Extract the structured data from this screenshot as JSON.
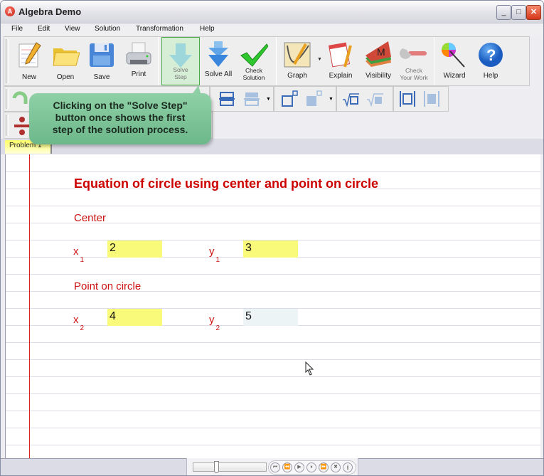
{
  "window": {
    "title": "Algebra Demo",
    "controls": {
      "minimize": "_",
      "maximize": "□",
      "close": "✕"
    }
  },
  "menu": [
    "File",
    "Edit",
    "View",
    "Solution",
    "Transformation",
    "Help"
  ],
  "toolbar": {
    "buttons": [
      {
        "id": "new",
        "label": "New",
        "icon": "new-document-icon"
      },
      {
        "id": "open",
        "label": "Open",
        "icon": "folder-icon"
      },
      {
        "id": "save",
        "label": "Save",
        "icon": "floppy-disk-icon"
      },
      {
        "id": "print",
        "label": "Print",
        "icon": "printer-icon"
      },
      {
        "id": "solve-step",
        "label_line1": "Solve",
        "label_line2": "Step",
        "icon": "arrow-down-icon",
        "active": true
      },
      {
        "id": "solve-all",
        "label": "Solve All",
        "icon": "double-arrow-down-icon"
      },
      {
        "id": "check-solution",
        "label_line1": "Check",
        "label_line2": "Solution",
        "icon": "checkmark-icon"
      },
      {
        "id": "graph",
        "label": "Graph",
        "icon": "graph-icon",
        "has_dropdown": true
      },
      {
        "id": "explain",
        "label": "Explain",
        "icon": "document-pencil-icon"
      },
      {
        "id": "visibility",
        "label": "Visibility",
        "icon": "layers-m-icon"
      },
      {
        "id": "check-your-work",
        "label_line1": "Check",
        "label_line2": "Your Work",
        "icon": "wrench-icon"
      },
      {
        "id": "wizard",
        "label": "Wizard",
        "icon": "magic-wand-icon"
      },
      {
        "id": "help",
        "label": "Help",
        "icon": "help-icon",
        "glyph": "?"
      }
    ]
  },
  "tooltip": {
    "text_line1": "Clicking on the \"Solve Step\"",
    "text_line2": "button once shows the first",
    "text_line3": "step of the solution process."
  },
  "tabs": [
    {
      "label": "Problem 1",
      "active": true
    }
  ],
  "document": {
    "title": "Equation of circle using center and point on circle",
    "sections": [
      {
        "heading": "Center",
        "fields": [
          {
            "var": "x",
            "sub": "1",
            "value": "2"
          },
          {
            "var": "y",
            "sub": "1",
            "value": "3"
          }
        ]
      },
      {
        "heading": "Point on circle",
        "fields": [
          {
            "var": "x",
            "sub": "2",
            "value": "4"
          },
          {
            "var": "y",
            "sub": "2",
            "value": "5"
          }
        ]
      }
    ]
  },
  "player": {
    "slider_fraction": 0.3,
    "buttons": [
      {
        "id": "first",
        "glyph": "⏮"
      },
      {
        "id": "rewind",
        "glyph": "⏪"
      },
      {
        "id": "play",
        "glyph": "▶"
      },
      {
        "id": "pause",
        "glyph": "⏸"
      },
      {
        "id": "fast-forward",
        "glyph": "⏩"
      },
      {
        "id": "stop",
        "glyph": "✖"
      },
      {
        "id": "info",
        "glyph": "i"
      }
    ]
  },
  "colors": {
    "heading_red": "#cc0000",
    "field_yellow": "#f9f97a",
    "field_alt": "#edf4f6",
    "tooltip_green": "#7cc497",
    "margin_line": "#dd2222"
  }
}
